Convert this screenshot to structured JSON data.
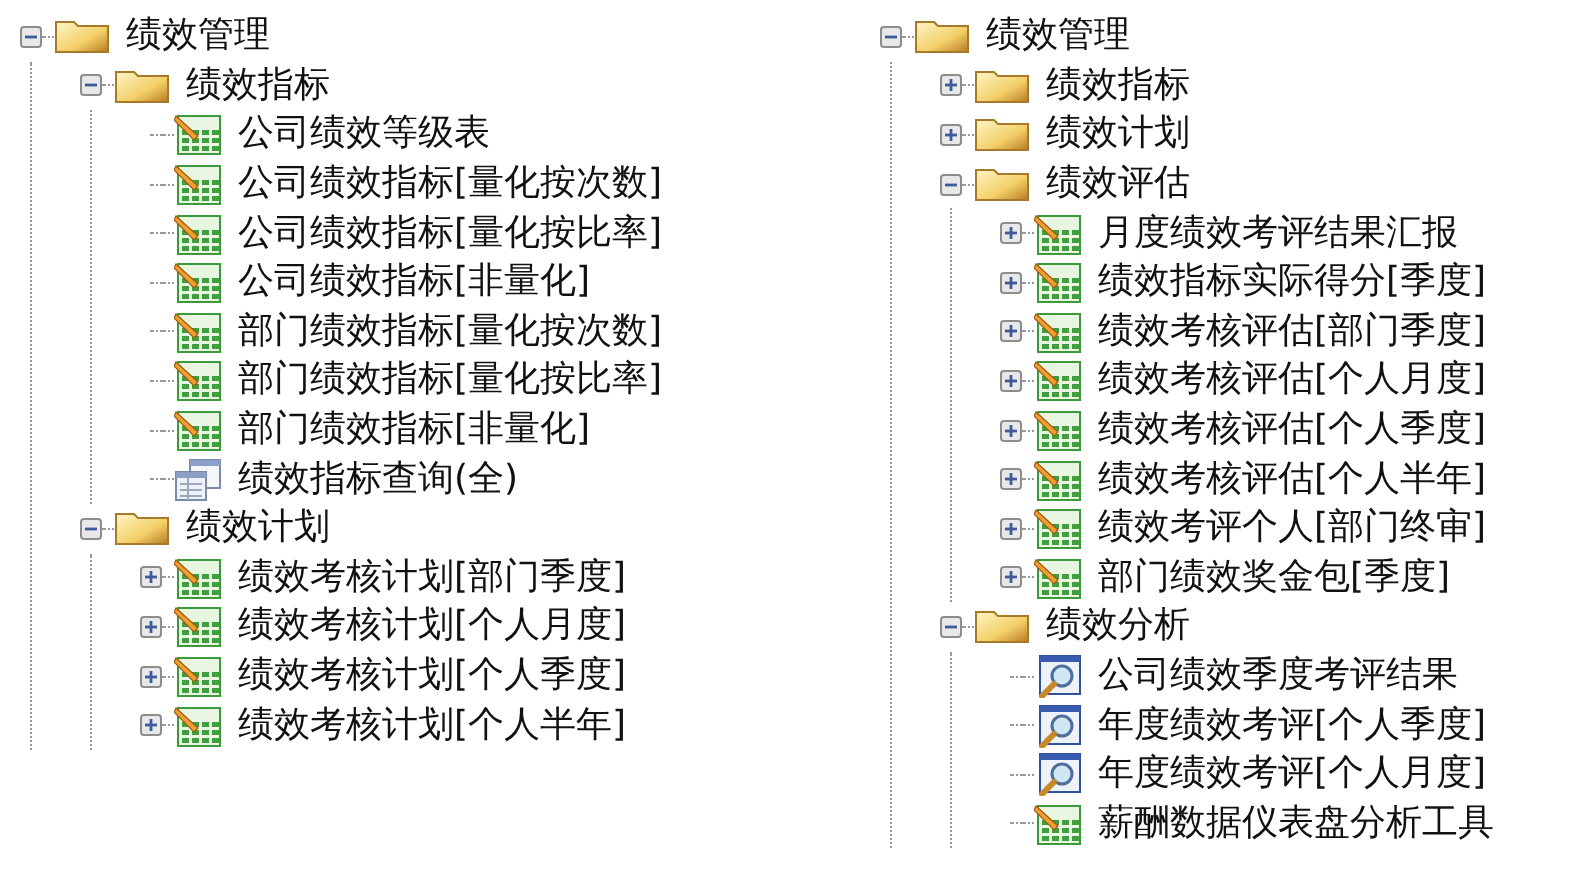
{
  "panels": [
    {
      "tree": [
        {
          "label": "绩效管理",
          "kind": "folder",
          "expanded": true,
          "children": [
            {
              "label": "绩效指标",
              "kind": "folder",
              "expanded": true,
              "children": [
                {
                  "label": "公司绩效等级表",
                  "kind": "report"
                },
                {
                  "label": "公司绩效指标[量化按次数]",
                  "kind": "report"
                },
                {
                  "label": "公司绩效指标[量化按比率]",
                  "kind": "report"
                },
                {
                  "label": "公司绩效指标[非量化]",
                  "kind": "report"
                },
                {
                  "label": "部门绩效指标[量化按次数]",
                  "kind": "report"
                },
                {
                  "label": "部门绩效指标[量化按比率]",
                  "kind": "report"
                },
                {
                  "label": "部门绩效指标[非量化]",
                  "kind": "report"
                },
                {
                  "label": "绩效指标查询(全)",
                  "kind": "query"
                }
              ]
            },
            {
              "label": "绩效计划",
              "kind": "folder",
              "expanded": true,
              "children": [
                {
                  "label": "绩效考核计划[部门季度]",
                  "kind": "report",
                  "expanded": false
                },
                {
                  "label": "绩效考核计划[个人月度]",
                  "kind": "report",
                  "expanded": false
                },
                {
                  "label": "绩效考核计划[个人季度]",
                  "kind": "report",
                  "expanded": false
                },
                {
                  "label": "绩效考核计划[个人半年]",
                  "kind": "report",
                  "expanded": false
                }
              ]
            }
          ]
        }
      ]
    },
    {
      "tree": [
        {
          "label": "绩效管理",
          "kind": "folder",
          "expanded": true,
          "children": [
            {
              "label": "绩效指标",
              "kind": "folder",
              "expanded": false
            },
            {
              "label": "绩效计划",
              "kind": "folder",
              "expanded": false
            },
            {
              "label": "绩效评估",
              "kind": "folder",
              "expanded": true,
              "children": [
                {
                  "label": "月度绩效考评结果汇报",
                  "kind": "report",
                  "expanded": false
                },
                {
                  "label": "绩效指标实际得分[季度]",
                  "kind": "report",
                  "expanded": false
                },
                {
                  "label": "绩效考核评估[部门季度]",
                  "kind": "report",
                  "expanded": false
                },
                {
                  "label": "绩效考核评估[个人月度]",
                  "kind": "report",
                  "expanded": false
                },
                {
                  "label": "绩效考核评估[个人季度]",
                  "kind": "report",
                  "expanded": false
                },
                {
                  "label": "绩效考核评估[个人半年]",
                  "kind": "report",
                  "expanded": false
                },
                {
                  "label": "绩效考评个人[部门终审]",
                  "kind": "report",
                  "expanded": false
                },
                {
                  "label": "部门绩效奖金包[季度]",
                  "kind": "report",
                  "expanded": false
                }
              ]
            },
            {
              "label": "绩效分析",
              "kind": "folder",
              "expanded": true,
              "children": [
                {
                  "label": "公司绩效季度考评结果",
                  "kind": "search"
                },
                {
                  "label": "年度绩效考评[个人季度]",
                  "kind": "search"
                },
                {
                  "label": "年度绩效考评[个人月度]",
                  "kind": "search"
                },
                {
                  "label": "薪酬数据仪表盘分析工具",
                  "kind": "report"
                }
              ]
            }
          ]
        }
      ]
    }
  ]
}
